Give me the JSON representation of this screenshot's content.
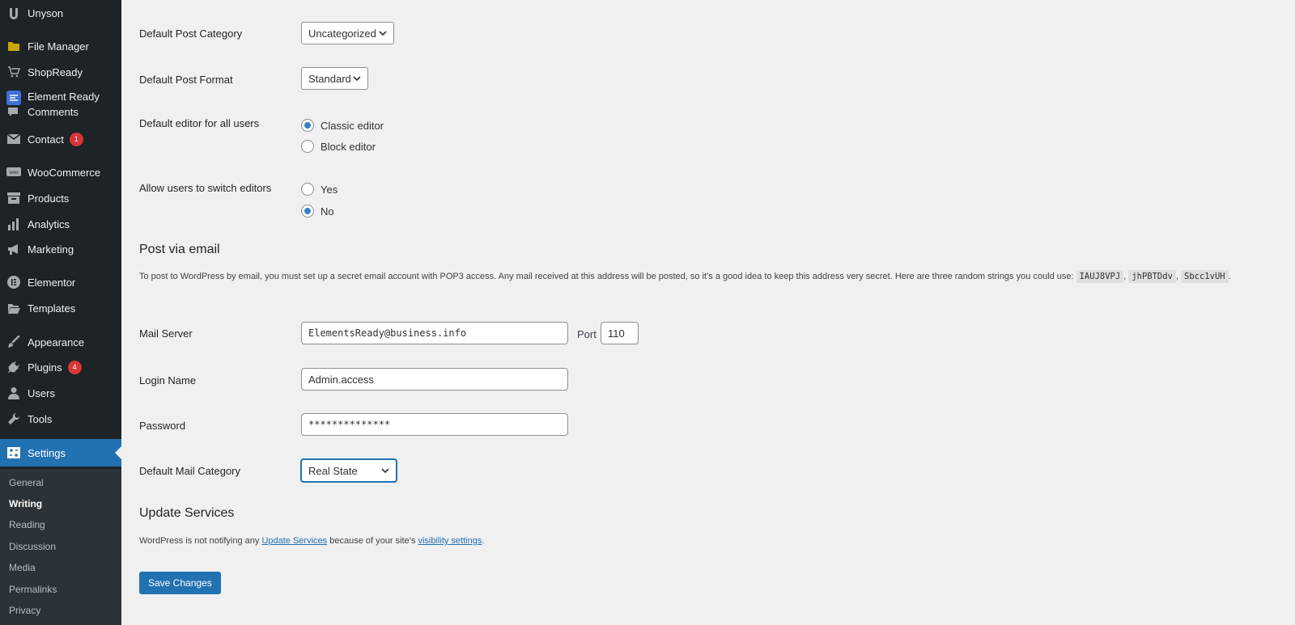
{
  "sidebar": {
    "items": [
      {
        "label": "Unyson",
        "icon": "unyson-icon"
      },
      {
        "label": "File Manager",
        "icon": "folder-icon"
      },
      {
        "label": "ShopReady",
        "icon": "cart-icon"
      },
      {
        "label": "Element Ready",
        "icon": "element-ready-icon"
      },
      {
        "label": "Comments",
        "icon": "comment-icon"
      },
      {
        "label": "Contact",
        "icon": "mail-icon",
        "badge": "1"
      },
      {
        "label": "WooCommerce",
        "icon": "woo-icon"
      },
      {
        "label": "Products",
        "icon": "archive-icon"
      },
      {
        "label": "Analytics",
        "icon": "bar-chart-icon"
      },
      {
        "label": "Marketing",
        "icon": "megaphone-icon"
      },
      {
        "label": "Elementor",
        "icon": "elementor-icon"
      },
      {
        "label": "Templates",
        "icon": "folder-open-icon"
      },
      {
        "label": "Appearance",
        "icon": "brush-icon"
      },
      {
        "label": "Plugins",
        "icon": "plugin-icon",
        "badge": "4"
      },
      {
        "label": "Users",
        "icon": "user-icon"
      },
      {
        "label": "Tools",
        "icon": "wrench-icon"
      },
      {
        "label": "Settings",
        "icon": "settings-icon"
      }
    ],
    "submenu": [
      "General",
      "Writing",
      "Reading",
      "Discussion",
      "Media",
      "Permalinks",
      "Privacy"
    ],
    "current_sub": "Writing"
  },
  "writing": {
    "default_category_label": "Default Post Category",
    "default_category_value": "Uncategorized",
    "default_format_label": "Default Post Format",
    "default_format_value": "Standard",
    "default_editor_label": "Default editor for all users",
    "editor_options": [
      "Classic editor",
      "Block editor"
    ],
    "editor_selected": "Classic editor",
    "switch_label": "Allow users to switch editors",
    "switch_options": [
      "Yes",
      "No"
    ],
    "switch_selected": "No"
  },
  "post_via_email": {
    "heading": "Post via email",
    "desc_text": "To post to WordPress by email, you must set up a secret email account with POP3 access. Any mail received at this address will be posted, so it’s a good idea to keep this address very secret. Here are three random strings you could use:",
    "random_strings": [
      "IAUJ8VPJ",
      "jhPBTDdv",
      "Sbcc1vUH"
    ],
    "comma": ",",
    "period": ".",
    "mail_server_label": "Mail Server",
    "mail_server_value": "ElementsReady@business.info",
    "port_label": "Port",
    "port_value": "110",
    "login_label": "Login Name",
    "login_value": "Admin.access",
    "password_label": "Password",
    "password_value": "**************",
    "mail_category_label": "Default Mail Category",
    "mail_category_value": "Real State"
  },
  "update_services": {
    "heading": "Update Services",
    "text_before": "WordPress is not notifying any",
    "link1": "Update Services",
    "text_middle": "because of your site’s",
    "link2": "visibility settings",
    "text_after": "."
  },
  "save_button": "Save Changes",
  "colors": {
    "sidebar_bg": "#1d2327",
    "accent": "#2271b1",
    "badge": "#d63638",
    "page_bg": "#f0f0f1"
  }
}
